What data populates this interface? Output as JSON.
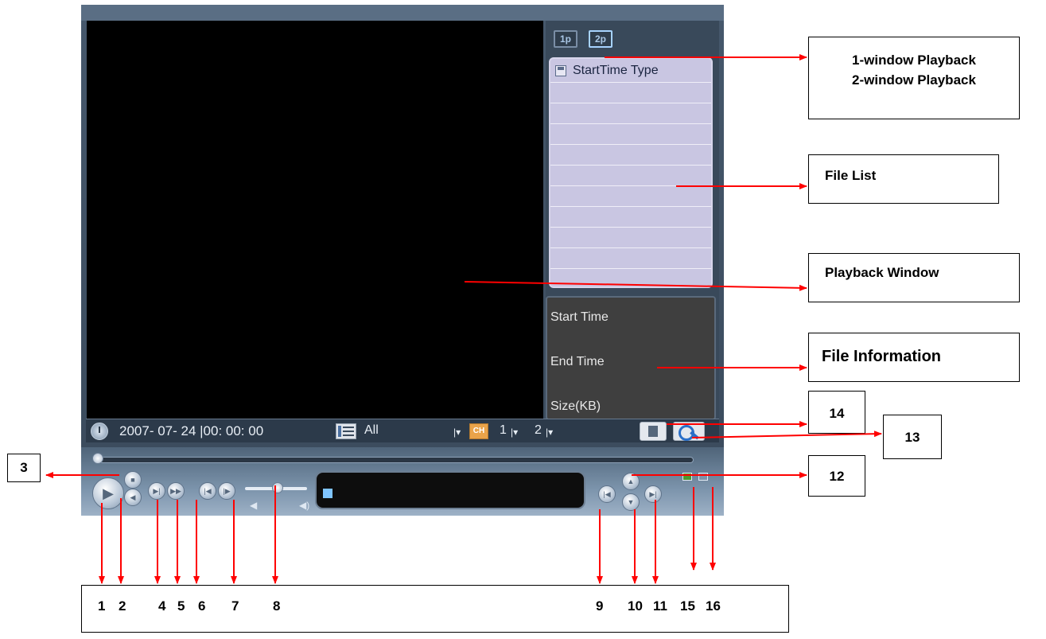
{
  "player": {
    "tabs": [
      "1p",
      "2p"
    ],
    "file_list_header": "StartTime Type",
    "file_info": {
      "start_label": "Start Time",
      "end_label": "End Time",
      "size_label": "Size(KB)"
    },
    "control_strip": {
      "date": "2007- 07- 24 |00: 00: 00",
      "type": "All",
      "channel_icon": "CH",
      "channel_1": "1",
      "channel_2": "2"
    },
    "icons": [
      "clock-icon",
      "list-icon",
      "channel-icon",
      "save-icon",
      "search-icon",
      "play-icon",
      "stop-icon",
      "speaker-icon"
    ]
  },
  "annotations": {
    "window_playback": [
      "1-window Playback",
      "2-window Playback"
    ],
    "file_list": "File List",
    "playback_window": "Playback Window",
    "file_information": "File Information",
    "n3": "3",
    "n12": "12",
    "n13": "13",
    "n14": "14",
    "bottom_numbers": [
      "1",
      "2",
      "4",
      "5",
      "6",
      "7",
      "8",
      "9",
      "10",
      "11",
      "15",
      "16"
    ]
  },
  "colors": {
    "arrow": "#ff0000",
    "panel": "#3a4a5c",
    "file_list_bg": "#c9c6e2"
  }
}
